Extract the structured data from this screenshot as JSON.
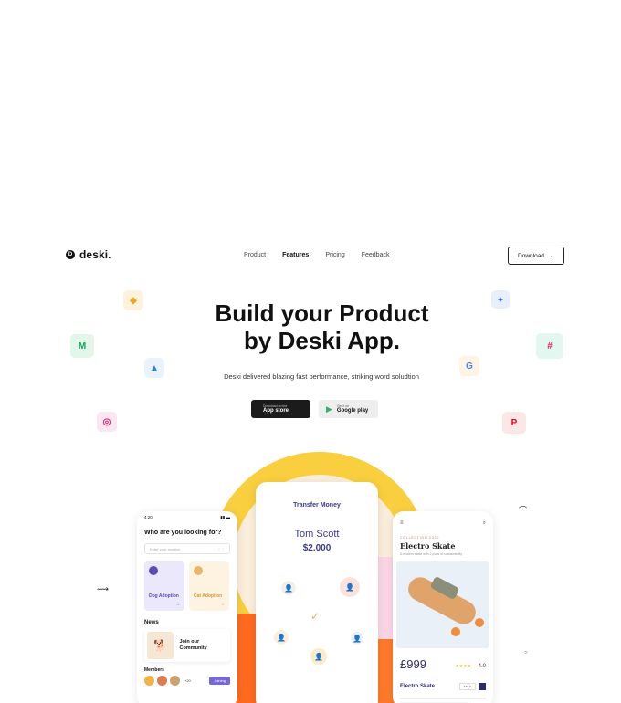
{
  "brand": {
    "logo_letter": "D",
    "name": "deski."
  },
  "nav": {
    "links": [
      "Product",
      "Features",
      "Pricing",
      "Feedback"
    ],
    "active": "Features",
    "download_label": "Download"
  },
  "hero": {
    "title_line1": "Build your Product",
    "title_line2": "by Deski App.",
    "subtitle": "Deski delivered blazing fast performance, striking word soludtion"
  },
  "stores": {
    "apple": {
      "small": "Download on the",
      "name": "App store"
    },
    "google": {
      "small": "Get it on",
      "name": "Google play"
    }
  },
  "floating_icons": [
    "sketch-icon",
    "medium-icon",
    "google-drive-icon",
    "instagram-icon",
    "dropbox-icon",
    "slack-icon",
    "google-icon",
    "pinterest-icon"
  ],
  "phone_left": {
    "time": "4:20",
    "title": "Who are you looking for?",
    "search_placeholder": "Enter your location",
    "cards": [
      {
        "label": "Dog Adoption"
      },
      {
        "label": "Cat Adoption"
      }
    ],
    "news_heading": "News",
    "news_card": "Join our Community",
    "members_heading": "Members",
    "members_more": "+20",
    "join_label": "Joining"
  },
  "phone_mid": {
    "title": "Transfer Money",
    "name": "Tom Scott",
    "amount": "$2.000"
  },
  "phone_right": {
    "collection": "COLLECTION 2020",
    "product_name": "Electro Skate",
    "description": "A modern skate with 2 ports of sustainability",
    "price": "£999",
    "rating": "4.0",
    "bottom_name": "Electro Skate",
    "qty": "Add to"
  },
  "colors": {
    "accent_yellow": "#f9cf3f",
    "accent_orange": "#ff6a1f",
    "phone_accent": "#3b3a8a"
  }
}
